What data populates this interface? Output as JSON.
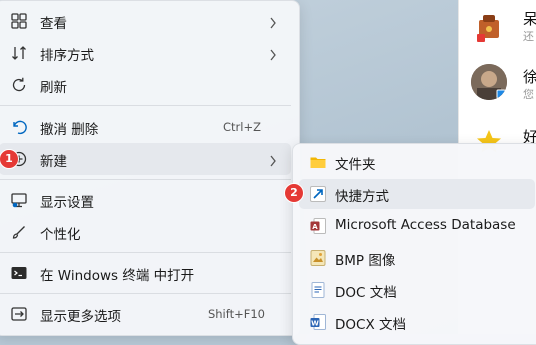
{
  "colors": {
    "accent": "#0067c0",
    "badge": "#e53935",
    "menu_bg": "#f4f6f9"
  },
  "chat": [
    {
      "name": "呆",
      "sub": "还",
      "icon": "bag-avatar-icon"
    },
    {
      "name": "徐",
      "sub": "您",
      "icon": "photo-avatar-icon"
    },
    {
      "name": "好",
      "sub": "",
      "icon": "star-avatar-icon"
    }
  ],
  "menu": {
    "view": "查看",
    "sort": "排序方式",
    "refresh": "刷新",
    "undo": "撤消 删除",
    "undo_shortcut": "Ctrl+Z",
    "new": "新建",
    "display": "显示设置",
    "personalize": "个性化",
    "terminal": "在 Windows 终端 中打开",
    "more": "显示更多选项",
    "more_shortcut": "Shift+F10"
  },
  "submenu": {
    "folder": "文件夹",
    "shortcut": "快捷方式",
    "access": "Microsoft Access Database",
    "bmp": "BMP 图像",
    "doc": "DOC 文档",
    "docx": "DOCX 文档"
  },
  "badges": {
    "one": "1",
    "two": "2"
  }
}
